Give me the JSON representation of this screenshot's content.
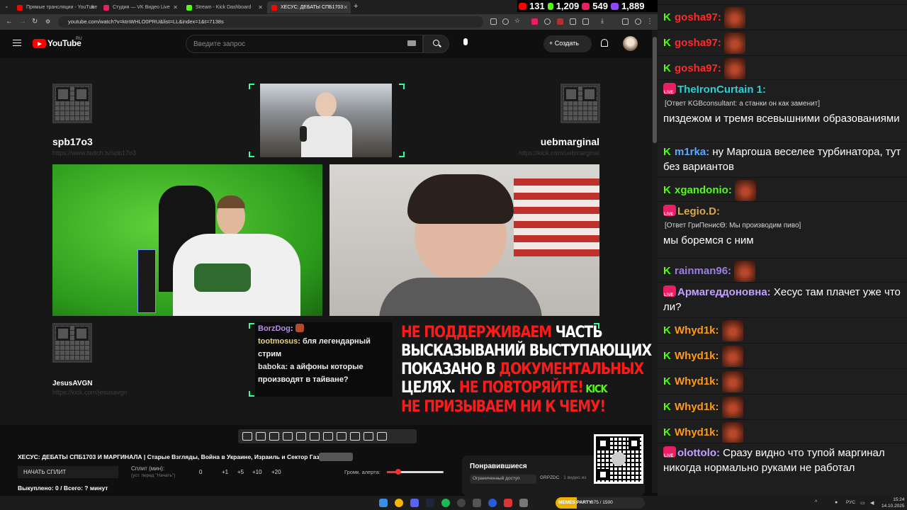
{
  "browser": {
    "tabs": [
      {
        "label": "Прямые трансляции - YouTube",
        "active": false
      },
      {
        "label": "Студия — VK Видео Live",
        "active": false
      },
      {
        "label": "Stream - Kick Dashboard",
        "active": false
      },
      {
        "label": "ХЕСУС: ДЕБАТЫ СПБ1703",
        "active": true
      }
    ],
    "url": "youtube.com/watch?v=ktnWHLO0PRU&list=LL&index=1&t=7138s"
  },
  "viewer_stats": [
    {
      "platform": "youtube",
      "value": "131",
      "color": "#ff0000"
    },
    {
      "platform": "kick",
      "value": "1,209",
      "color": "#53fc18"
    },
    {
      "platform": "vk",
      "value": "549",
      "color": "#e91e63"
    },
    {
      "platform": "twitch",
      "value": "1,889",
      "color": "#9146ff"
    }
  ],
  "youtube": {
    "logo_text": "YouTube",
    "country": "RU",
    "search_placeholder": "Введите запрос",
    "create_label": "Создать"
  },
  "stream": {
    "streamers": [
      {
        "name": "spb17o3",
        "url": "https://www.twitch.tv/spb17o3"
      },
      {
        "name": "uebmarginal",
        "url": "https://kick.com/uebmarginal"
      },
      {
        "name": "JesusAVGN",
        "url": "https://kick.com/jesusavgn"
      }
    ],
    "chat_overlay": [
      {
        "nick": "BorzDog",
        "text": ": "
      },
      {
        "nick": "tootmosus",
        "text": ": бля легендарный стрим"
      },
      {
        "nick": "baboka",
        "text": ": а айфоны которые производят в тайване?"
      }
    ],
    "banner": {
      "line1_red": "НЕ ПОДДЕРЖИВАЕМ",
      "line1_white": " ЧАСТЬ",
      "line2": "ВЫСКАЗЫВАНИЙ ВЫСТУПАЮЩИХ",
      "line3_white": "ПОКАЗАНО В ",
      "line3_red": "ДОКУМЕНТАЛЬНЫХ",
      "line4_white": "ЦЕЛЯХ. ",
      "line4_red": "НЕ ПОВТОРЯЙТЕ!",
      "line4_kick": " KICK",
      "line5": "НЕ ПРИЗЫВАЕМ НИ К ЧЕМУ!"
    }
  },
  "panel": {
    "title": "ХЕСУС: ДЕБАТЫ СПБ1703 И МАРГИНАЛА | Старые Взгляды, Война в Украине, Израиль и Сектор Газа",
    "split_button": "НАЧАТЬ СПЛИТ",
    "split_label": "Сплит (мин):",
    "split_hint": "(уст. перед \"Начать\")",
    "split_value": "0",
    "split_steps": [
      "+1",
      "+5",
      "+10",
      "+20"
    ],
    "volume_label": "Громк. алерта:",
    "volume_fraction": 0.2,
    "bought": "Выкуплено: 0 / Всего: ? минут"
  },
  "liked": {
    "title": "Понравившиеся",
    "limited": "Ограниченный доступ",
    "owner": "GRPZDC",
    "count": "· 1 видео из"
  },
  "chat": [
    {
      "platform": "kick",
      "user": "gosha97:",
      "color": "#ff2a2a",
      "text": "",
      "emote": true
    },
    {
      "platform": "kick",
      "user": "gosha97:",
      "color": "#ff2a2a",
      "text": "",
      "emote": true
    },
    {
      "platform": "kick",
      "user": "gosha97:",
      "color": "#ff2a2a",
      "text": "",
      "emote": true
    },
    {
      "platform": "live",
      "user": "TheIronCurtain 1:",
      "color": "#2ad0d6",
      "reply": "[Ответ KGBconsultant: а станки он как заменит]",
      "text": "пиздежом и тремя всевышними образованиями"
    },
    {
      "platform": "kick",
      "user": "m1rka:",
      "color": "#5da9ff",
      "text": " ну Маргоша веселее турбинатора, тут без вариантов"
    },
    {
      "platform": "kick",
      "user": "xgandonio:",
      "color": "#53fc18",
      "text": "",
      "emote": true
    },
    {
      "platform": "live",
      "user": "Legio.D:",
      "color": "#d4a84a",
      "reply": "[Ответ ГриПенисӨ: Мы производим пиво]",
      "text": "мы боремся с ним"
    },
    {
      "platform": "kick",
      "user": "rainman96:",
      "color": "#9a7fe0",
      "text": "",
      "emote": true
    },
    {
      "platform": "live",
      "user": "Армагеддоновна:",
      "color": "#c3a0ff",
      "text": " Хесус там плачет уже что ли?"
    },
    {
      "platform": "kick",
      "user": "Whyd1k:",
      "color": "#ff9a1a",
      "text": "",
      "emote": true
    },
    {
      "platform": "kick",
      "user": "Whyd1k:",
      "color": "#ff9a1a",
      "text": "",
      "emote": true
    },
    {
      "platform": "kick",
      "user": "Whyd1k:",
      "color": "#ff9a1a",
      "text": "",
      "emote": true
    },
    {
      "platform": "kick",
      "user": "Whyd1k:",
      "color": "#ff9a1a",
      "text": "",
      "emote": true
    },
    {
      "platform": "kick",
      "user": "Whyd1k:",
      "color": "#ff9a1a",
      "text": "",
      "emote": true
    },
    {
      "platform": "live",
      "user": "olottolo:",
      "color": "#c3a0ff",
      "text": " Сразу видно что тупой маргинал никогда нормально руками не работал"
    }
  ],
  "taskbar": {
    "memes_label": "MEMES PARTY",
    "memes_count": "875 / 1500",
    "lang": "РУС",
    "time": "15:24",
    "date": "14.10.2025"
  }
}
